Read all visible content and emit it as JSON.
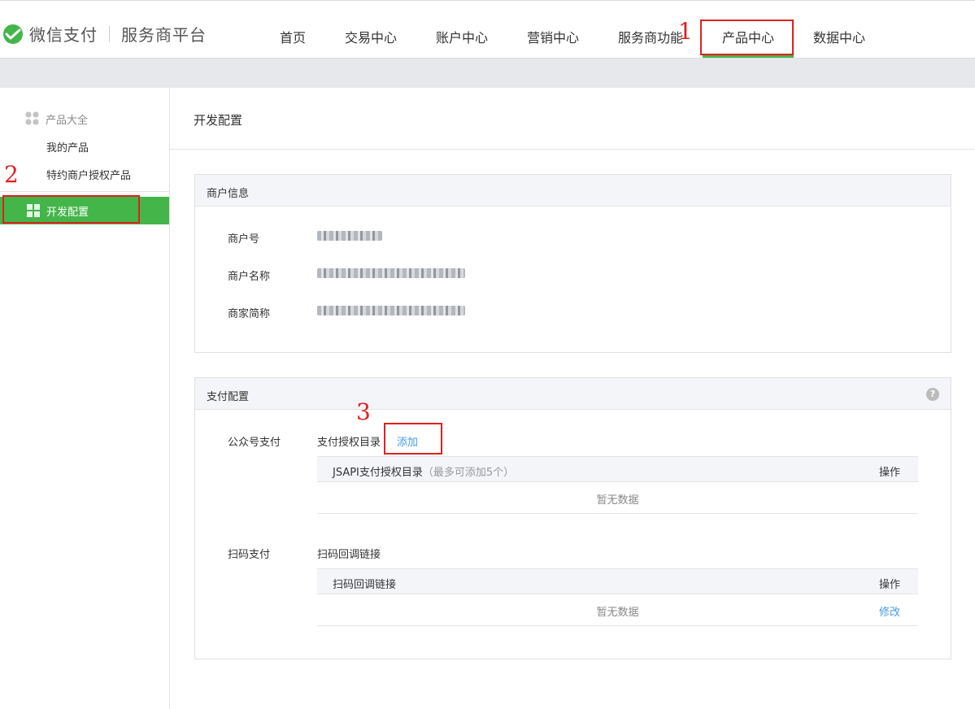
{
  "brand": {
    "name": "微信支付",
    "platform": "服务商平台"
  },
  "nav": {
    "items": [
      "首页",
      "交易中心",
      "账户中心",
      "营销中心",
      "服务商功能",
      "产品中心",
      "数据中心"
    ],
    "active": "产品中心"
  },
  "sidebar": {
    "group_label": "产品大全",
    "items": [
      "我的产品",
      "特约商户授权产品"
    ],
    "active_label": "开发配置"
  },
  "page": {
    "title": "开发配置"
  },
  "merchant_info": {
    "heading": "商户信息",
    "fields": [
      {
        "label": "商户号"
      },
      {
        "label": "商户名称"
      },
      {
        "label": "商家简称"
      }
    ]
  },
  "pay_config": {
    "heading": "支付配置",
    "help_glyph": "?",
    "jsapi": {
      "label": "公众号支付",
      "desc": "支付授权目录",
      "add_link": "添加",
      "table_col": "JSAPI支付授权目录",
      "table_hint": "（最多可添加5个）",
      "op_col": "操作",
      "empty": "暂无数据"
    },
    "native": {
      "label": "扫码支付",
      "desc": "扫码回调链接",
      "table_col": "扫码回调链接",
      "op_col": "操作",
      "empty": "暂无数据",
      "edit_link": "修改"
    }
  },
  "annotations": [
    "1",
    "2",
    "3"
  ],
  "colors": {
    "accent": "#44b549",
    "link": "#459ae9",
    "annotation": "#e02020"
  }
}
